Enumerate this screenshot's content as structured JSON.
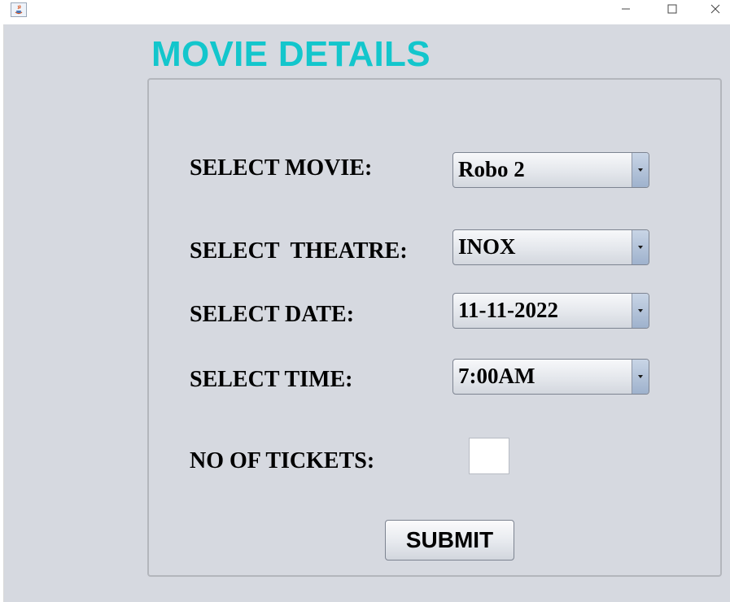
{
  "window": {
    "title": "",
    "controls": {
      "minimize_icon": "minimize-icon",
      "maximize_icon": "maximize-icon",
      "close_icon": "close-icon"
    }
  },
  "page": {
    "title": "MOVIE DETAILS",
    "title_color": "#13c6cc",
    "background": "#d6d9e0"
  },
  "form": {
    "movie": {
      "label": "SELECT MOVIE:",
      "value": "Robo 2"
    },
    "theatre": {
      "label": "SELECT  THEATRE:",
      "value": "INOX"
    },
    "date": {
      "label": "SELECT DATE:",
      "value": "11-11-2022"
    },
    "time": {
      "label": "SELECT TIME:",
      "value": "7:00AM"
    },
    "tickets": {
      "label": "NO OF TICKETS:",
      "value": ""
    },
    "submit_label": "SUBMIT"
  }
}
